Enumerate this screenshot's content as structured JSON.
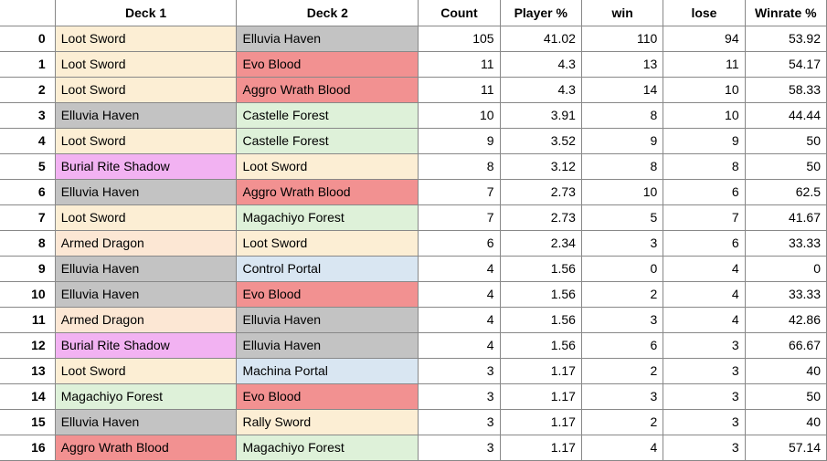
{
  "columns": {
    "rowhead": "",
    "deck1": "Deck 1",
    "deck2": "Deck 2",
    "count": "Count",
    "playerpct": "Player %",
    "win": "win",
    "lose": "lose",
    "winratepct": "Winrate %"
  },
  "deck_classes": {
    "Loot Sword": "c-sword",
    "Rally Sword": "c-sword",
    "Elluvia Haven": "c-haven",
    "Evo Blood": "c-blood",
    "Aggro Wrath Blood": "c-blood",
    "Castelle Forest": "c-forest",
    "Magachiyo Forest": "c-forest",
    "Burial Rite Shadow": "c-shadow",
    "Armed Dragon": "c-dragon",
    "Control Portal": "c-portal",
    "Machina Portal": "c-portal"
  },
  "rows": [
    {
      "idx": "0",
      "deck1": "Loot Sword",
      "deck2": "Elluvia Haven",
      "count": "105",
      "playerpct": "41.02",
      "win": "110",
      "lose": "94",
      "winratepct": "53.92"
    },
    {
      "idx": "1",
      "deck1": "Loot Sword",
      "deck2": "Evo Blood",
      "count": "11",
      "playerpct": "4.3",
      "win": "13",
      "lose": "11",
      "winratepct": "54.17"
    },
    {
      "idx": "2",
      "deck1": "Loot Sword",
      "deck2": "Aggro Wrath Blood",
      "count": "11",
      "playerpct": "4.3",
      "win": "14",
      "lose": "10",
      "winratepct": "58.33"
    },
    {
      "idx": "3",
      "deck1": "Elluvia Haven",
      "deck2": "Castelle Forest",
      "count": "10",
      "playerpct": "3.91",
      "win": "8",
      "lose": "10",
      "winratepct": "44.44"
    },
    {
      "idx": "4",
      "deck1": "Loot Sword",
      "deck2": "Castelle Forest",
      "count": "9",
      "playerpct": "3.52",
      "win": "9",
      "lose": "9",
      "winratepct": "50"
    },
    {
      "idx": "5",
      "deck1": "Burial Rite Shadow",
      "deck2": "Loot Sword",
      "count": "8",
      "playerpct": "3.12",
      "win": "8",
      "lose": "8",
      "winratepct": "50"
    },
    {
      "idx": "6",
      "deck1": "Elluvia Haven",
      "deck2": "Aggro Wrath Blood",
      "count": "7",
      "playerpct": "2.73",
      "win": "10",
      "lose": "6",
      "winratepct": "62.5"
    },
    {
      "idx": "7",
      "deck1": "Loot Sword",
      "deck2": "Magachiyo Forest",
      "count": "7",
      "playerpct": "2.73",
      "win": "5",
      "lose": "7",
      "winratepct": "41.67"
    },
    {
      "idx": "8",
      "deck1": "Armed Dragon",
      "deck2": "Loot Sword",
      "count": "6",
      "playerpct": "2.34",
      "win": "3",
      "lose": "6",
      "winratepct": "33.33"
    },
    {
      "idx": "9",
      "deck1": "Elluvia Haven",
      "deck2": "Control Portal",
      "count": "4",
      "playerpct": "1.56",
      "win": "0",
      "lose": "4",
      "winratepct": "0"
    },
    {
      "idx": "10",
      "deck1": "Elluvia Haven",
      "deck2": "Evo Blood",
      "count": "4",
      "playerpct": "1.56",
      "win": "2",
      "lose": "4",
      "winratepct": "33.33"
    },
    {
      "idx": "11",
      "deck1": "Armed Dragon",
      "deck2": "Elluvia Haven",
      "count": "4",
      "playerpct": "1.56",
      "win": "3",
      "lose": "4",
      "winratepct": "42.86"
    },
    {
      "idx": "12",
      "deck1": "Burial Rite Shadow",
      "deck2": "Elluvia Haven",
      "count": "4",
      "playerpct": "1.56",
      "win": "6",
      "lose": "3",
      "winratepct": "66.67"
    },
    {
      "idx": "13",
      "deck1": "Loot Sword",
      "deck2": "Machina Portal",
      "count": "3",
      "playerpct": "1.17",
      "win": "2",
      "lose": "3",
      "winratepct": "40"
    },
    {
      "idx": "14",
      "deck1": "Magachiyo Forest",
      "deck2": "Evo Blood",
      "count": "3",
      "playerpct": "1.17",
      "win": "3",
      "lose": "3",
      "winratepct": "50"
    },
    {
      "idx": "15",
      "deck1": "Elluvia Haven",
      "deck2": "Rally Sword",
      "count": "3",
      "playerpct": "1.17",
      "win": "2",
      "lose": "3",
      "winratepct": "40"
    },
    {
      "idx": "16",
      "deck1": "Aggro Wrath Blood",
      "deck2": "Magachiyo Forest",
      "count": "3",
      "playerpct": "1.17",
      "win": "4",
      "lose": "3",
      "winratepct": "57.14"
    }
  ]
}
